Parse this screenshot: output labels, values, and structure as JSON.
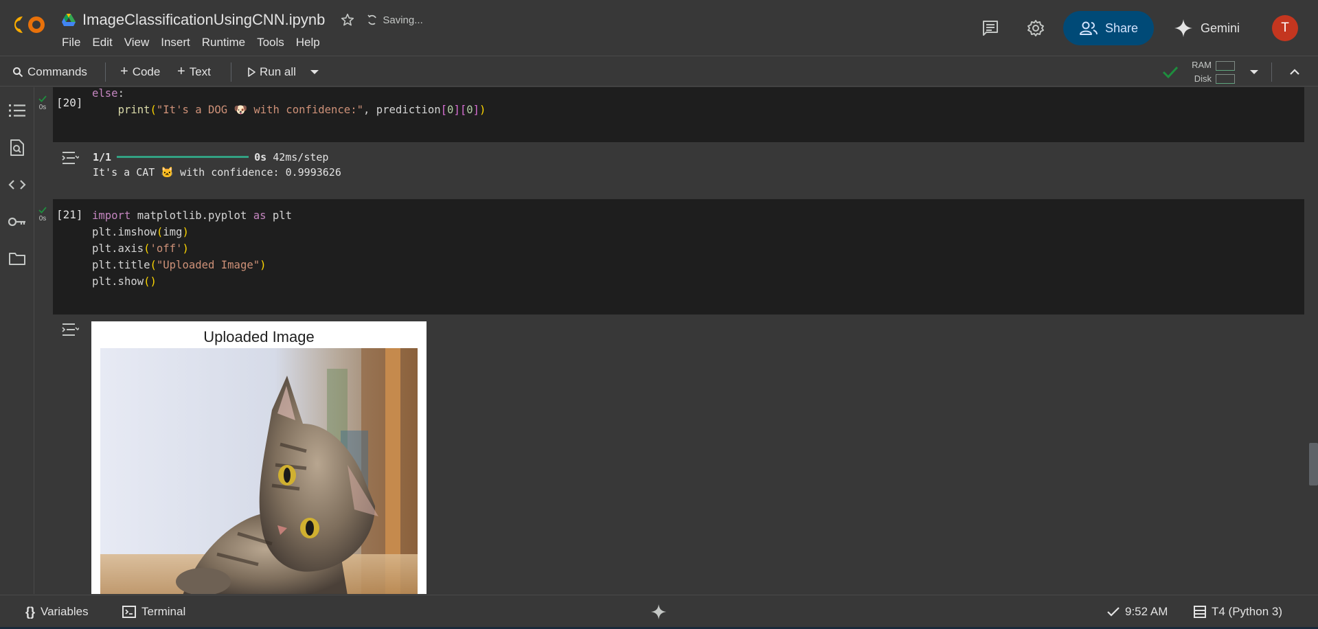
{
  "header": {
    "notebook_title": "ImageClassificationUsingCNN.ipynb",
    "saving_status": "Saving...",
    "menu": [
      "File",
      "Edit",
      "View",
      "Insert",
      "Runtime",
      "Tools",
      "Help"
    ],
    "share_label": "Share",
    "gemini_label": "Gemini",
    "avatar_initial": "T"
  },
  "toolbar": {
    "commands_label": "Commands",
    "code_label": "Code",
    "text_label": "Text",
    "run_all_label": "Run all",
    "ram_label": "RAM",
    "disk_label": "Disk"
  },
  "cells": [
    {
      "exec_count": "[20]",
      "status_time": "0s",
      "output_progress_label": "1/1",
      "output_time": "0s",
      "output_step": "42ms/step",
      "output_result": "It's a CAT 🐱 with confidence: 0.9993626"
    },
    {
      "exec_count": "[21]",
      "status_time": "0s",
      "figure_title": "Uploaded Image"
    }
  ],
  "statusbar": {
    "variables_label": "Variables",
    "terminal_label": "Terminal",
    "time_label": "9:52 AM",
    "runtime_label": "T4 (Python 3)"
  },
  "colors": {
    "background": "#383838",
    "cell_background": "#1e1e1e",
    "share_button": "#004a77",
    "avatar": "#c4361f",
    "progress": "#32a283",
    "success_check": "#1e8e3e"
  }
}
